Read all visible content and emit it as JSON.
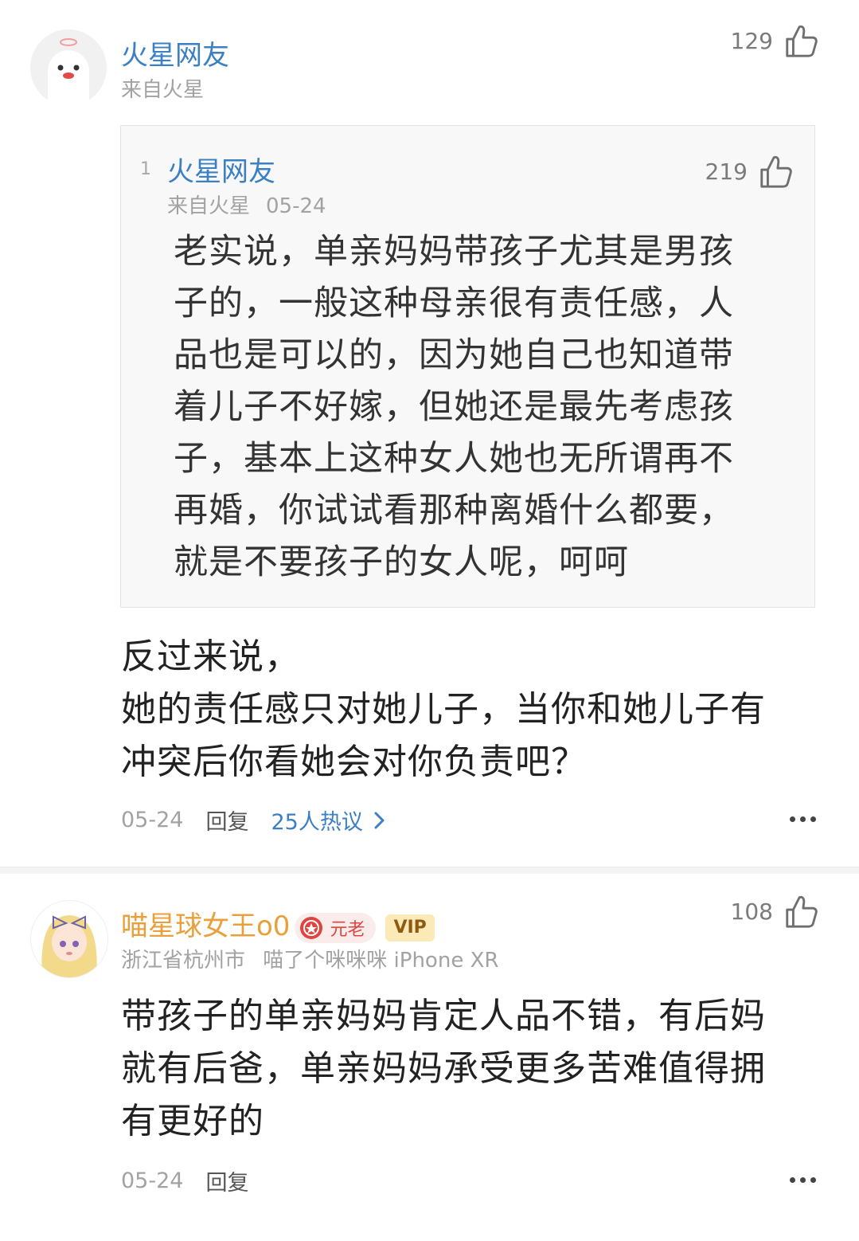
{
  "comments": [
    {
      "username": "火星网友",
      "location": "来自火星",
      "likes": "129",
      "quote": {
        "index": "1",
        "username": "火星网友",
        "location": "来自火星",
        "date": "05-24",
        "likes": "219",
        "lines": [
          "老实说，单亲妈妈带孩子尤其是男孩",
          "子的，一般这种母亲很有责任感，人",
          "品也是可以的，因为她自己也知道带",
          "着儿子不好嫁，但她还是最先考虑孩",
          "子，基本上这种女人她也无所谓再不",
          "再婚，你试试看那种离婚什么都要，",
          "就是不要孩子的女人呢，呵呵"
        ]
      },
      "lines": [
        "反过来说，",
        "她的责任感只对她儿子，当你和她儿子有",
        "冲突后你看她会对你负责吧？"
      ],
      "date": "05-24",
      "reply_label": "回复",
      "hot_label": "25人热议"
    },
    {
      "username": "喵星球女王o0",
      "badge_label": "元老",
      "vip_label": "VIP",
      "location": "浙江省杭州市",
      "device": "喵了个咪咪咪 iPhone XR",
      "likes": "108",
      "lines": [
        "带孩子的单亲妈妈肯定人品不错，有后妈",
        "就有后爸，单亲妈妈承受更多苦难值得拥",
        "有更好的"
      ],
      "date": "05-24",
      "reply_label": "回复"
    }
  ],
  "colors": {
    "link_blue": "#3b7fc4",
    "gold_username": "#e9a03a",
    "meta_gray": "#a2a2a2"
  },
  "icons": [
    "thumbs-up-icon",
    "chevron-right-icon",
    "more-icon",
    "medal-icon"
  ]
}
